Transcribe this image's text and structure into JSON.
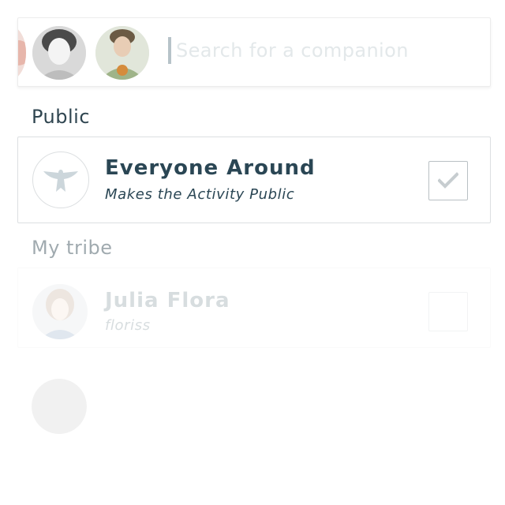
{
  "search": {
    "placeholder": "Search for a companion",
    "selected_companions": [
      {
        "icon": "partial-avatar-icon"
      },
      {
        "icon": "woman-avatar-icon"
      },
      {
        "icon": "man-avatar-icon"
      }
    ]
  },
  "public_section": {
    "title": "Public",
    "option": {
      "name": "Everyone Around",
      "subtitle": "Makes the Activity Public",
      "icon": "bird-icon",
      "checked": true
    }
  },
  "tribe_section": {
    "title": "My tribe",
    "members": [
      {
        "name": "Julia Flora",
        "handle": "floriss",
        "checked": false
      }
    ]
  },
  "colors": {
    "text": "#2a4654",
    "border": "#dcdfe1",
    "check": "#c7cdd0",
    "placeholder": "#e3e8ea"
  }
}
